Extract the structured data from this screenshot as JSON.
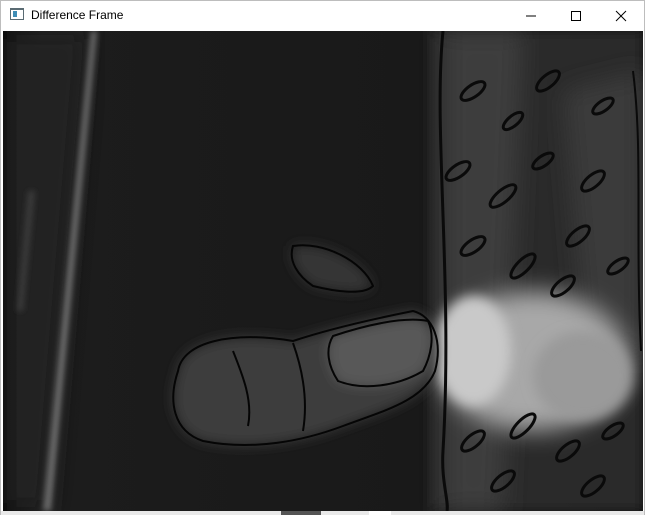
{
  "window": {
    "title": "Difference Frame",
    "icon": "opencv-window-icon",
    "controls": {
      "minimize_icon": "minimize-icon",
      "maximize_icon": "maximize-icon",
      "close_icon": "close-icon"
    }
  },
  "canvas": {
    "content": "grayscale frame-difference image",
    "background_color": "#141414"
  }
}
